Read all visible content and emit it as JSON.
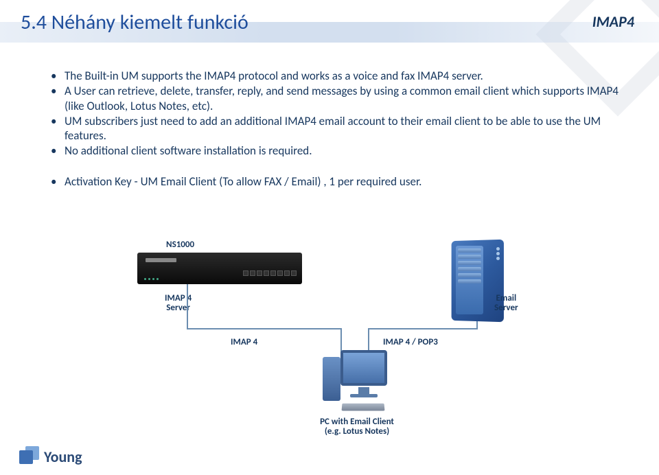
{
  "header": {
    "title": "5.4 Néhány kiemelt funkció",
    "tag": "IMAP4"
  },
  "bullets": {
    "b1": "The Built-in UM supports the IMAP4 protocol and works as a voice and fax IMAP4 server.",
    "b2": "A User can retrieve, delete, transfer, reply, and send messages by using a common email client which supports IMAP4 (like Outlook, Lotus Notes, etc).",
    "b3": "UM subscribers just need to add an additional IMAP4 email account to their email client to be able to use the UM features.",
    "b4": "No additional client software installation is required.",
    "b5": "Activation Key - UM Email Client (To allow FAX / Email) , 1 per required user."
  },
  "diagram": {
    "ns": "NS1000",
    "imap_server": "IMAP 4\nServer",
    "email_server": "Email\nServer",
    "imap4": "IMAP 4",
    "imap4_pop3": "IMAP 4 / POP3",
    "pc": "PC with Email Client\n(e.g. Lotus Notes)"
  },
  "logo": {
    "text": "Young"
  }
}
